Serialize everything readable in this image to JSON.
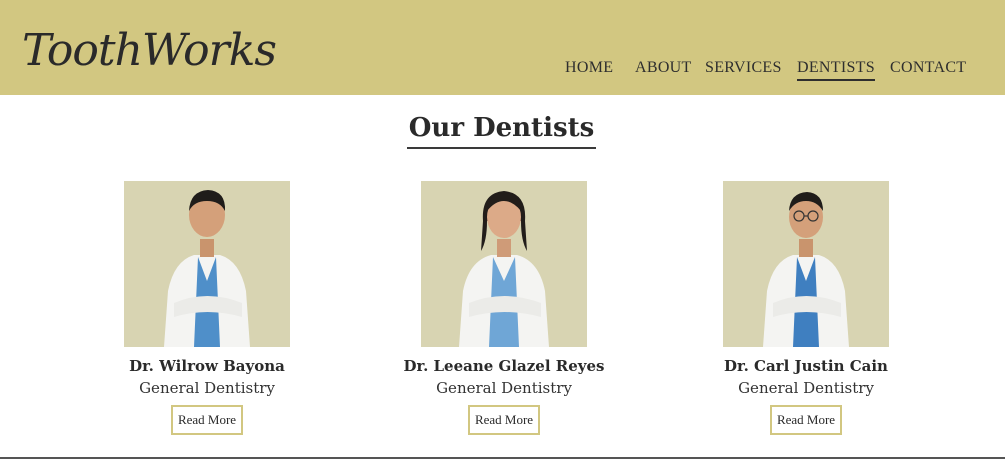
{
  "brand": {
    "logo_text": "ToothWorks"
  },
  "nav": {
    "items": [
      {
        "label": "HOME"
      },
      {
        "label": "ABOUT"
      },
      {
        "label": "SERVICES"
      },
      {
        "label": "DENTISTS",
        "active": true
      },
      {
        "label": "CONTACT"
      }
    ]
  },
  "colors": {
    "header_bg": "#d2c781",
    "photo_bg": "#d8d4b2",
    "button_border": "#d2c781"
  },
  "section": {
    "title": "Our Dentists"
  },
  "dentists": [
    {
      "name": "Dr. Wilrow Bayona",
      "role": "General Dentistry",
      "button": "Read More"
    },
    {
      "name": "Dr. Leeane Glazel Reyes",
      "role": "General Dentistry",
      "button": "Read More"
    },
    {
      "name": "Dr. Carl Justin Cain",
      "role": "General Dentistry",
      "button": "Read More"
    }
  ]
}
